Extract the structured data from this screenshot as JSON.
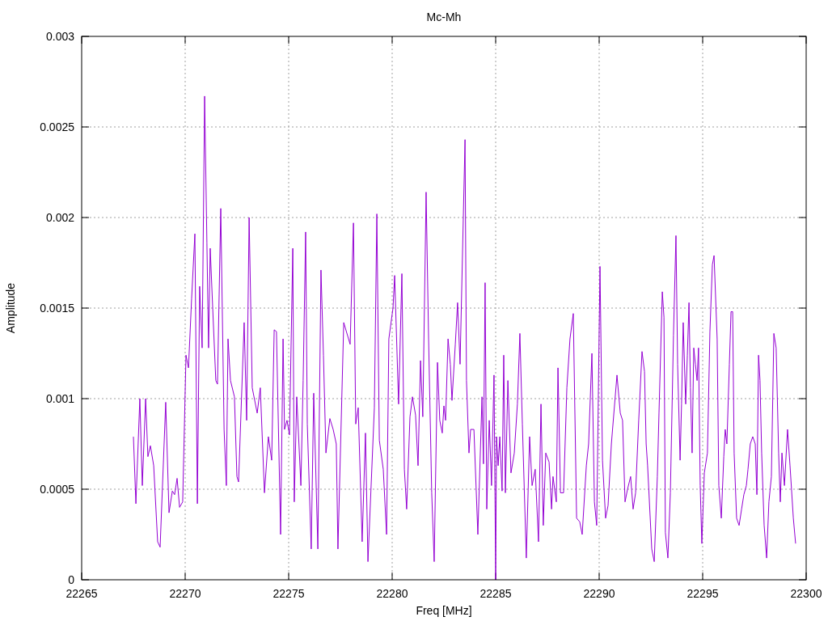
{
  "plot": {
    "chart_data": {
      "type": "line",
      "grid": true,
      "title": "Mc-Mh",
      "xlabel": "Freq [MHz]",
      "ylabel": "Amplitude",
      "xlim": [
        22265,
        22300
      ],
      "ylim": [
        0,
        0.003
      ],
      "xticks": [
        22265,
        22270,
        22275,
        22280,
        22285,
        22290,
        22295,
        22300
      ],
      "yticks": [
        0,
        0.0005,
        0.001,
        0.0015,
        0.002,
        0.0025,
        0.003
      ],
      "x": [
        22267.5,
        22267.62,
        22267.81,
        22267.93,
        22268.09,
        22268.2,
        22268.32,
        22268.48,
        22268.67,
        22268.79,
        22269.06,
        22269.22,
        22269.38,
        22269.49,
        22269.61,
        22269.73,
        22269.88,
        22270.04,
        22270.16,
        22270.31,
        22270.47,
        22270.59,
        22270.7,
        22270.82,
        22270.94,
        22271.05,
        22271.13,
        22271.21,
        22271.33,
        22271.48,
        22271.56,
        22271.72,
        22271.88,
        22271.99,
        22272.07,
        22272.19,
        22272.38,
        22272.5,
        22272.58,
        22272.85,
        22272.97,
        22273.09,
        22273.24,
        22273.48,
        22273.63,
        22273.83,
        22274.02,
        22274.18,
        22274.3,
        22274.41,
        22274.61,
        22274.73,
        22274.8,
        22274.92,
        22275.04,
        22275.2,
        22275.27,
        22275.39,
        22275.59,
        22275.7,
        22275.82,
        22275.9,
        22276.09,
        22276.21,
        22276.41,
        22276.56,
        22276.68,
        22276.8,
        22276.99,
        22277.15,
        22277.3,
        22277.38,
        22277.66,
        22277.97,
        22278.13,
        22278.24,
        22278.36,
        22278.55,
        22278.71,
        22278.83,
        22279.14,
        22279.26,
        22279.38,
        22279.57,
        22279.73,
        22279.84,
        22280.04,
        22280.12,
        22280.31,
        22280.47,
        22280.59,
        22280.7,
        22280.86,
        22280.98,
        22281.13,
        22281.25,
        22281.37,
        22281.48,
        22281.64,
        22281.76,
        22281.91,
        22282.03,
        22282.19,
        22282.3,
        22282.42,
        22282.5,
        22282.58,
        22282.7,
        22282.81,
        22282.89,
        22283.05,
        22283.16,
        22283.28,
        22283.52,
        22283.59,
        22283.71,
        22283.79,
        22283.95,
        22284.14,
        22284.34,
        22284.41,
        22284.49,
        22284.57,
        22284.69,
        22284.8,
        22284.92,
        22285.0,
        22285.04,
        22285.12,
        22285.2,
        22285.31,
        22285.39,
        22285.47,
        22285.59,
        22285.74,
        22285.9,
        22286.05,
        22286.17,
        22286.29,
        22286.48,
        22286.64,
        22286.76,
        22286.91,
        22287.07,
        22287.19,
        22287.3,
        22287.42,
        22287.58,
        22287.7,
        22287.77,
        22287.93,
        22288.01,
        22288.13,
        22288.28,
        22288.44,
        22288.59,
        22288.75,
        22288.91,
        22289.06,
        22289.18,
        22289.38,
        22289.49,
        22289.65,
        22289.77,
        22289.88,
        22290.04,
        22290.16,
        22290.31,
        22290.43,
        22290.59,
        22290.86,
        22291.02,
        22291.13,
        22291.25,
        22291.37,
        22291.52,
        22291.64,
        22291.76,
        22291.91,
        22292.07,
        22292.19,
        22292.27,
        22292.34,
        22292.54,
        22292.66,
        22292.81,
        22292.89,
        22293.05,
        22293.13,
        22293.2,
        22293.32,
        22293.44,
        22293.59,
        22293.71,
        22293.79,
        22293.91,
        22293.98,
        22294.06,
        22294.18,
        22294.26,
        22294.34,
        22294.41,
        22294.49,
        22294.57,
        22294.65,
        22294.73,
        22294.8,
        22294.88,
        22294.96,
        22295.08,
        22295.23,
        22295.35,
        22295.47,
        22295.55,
        22295.7,
        22295.78,
        22295.9,
        22296.02,
        22296.09,
        22296.17,
        22296.29,
        22296.37,
        22296.45,
        22296.52,
        22296.64,
        22296.76,
        22296.88,
        22296.99,
        22297.11,
        22297.19,
        22297.3,
        22297.42,
        22297.54,
        22297.62,
        22297.7,
        22297.77,
        22297.85,
        22297.97,
        22298.09,
        22298.2,
        22298.32,
        22298.44,
        22298.55,
        22298.67,
        22298.75,
        22298.83,
        22298.95,
        22299.1,
        22299.22,
        22299.38,
        22299.49
      ],
      "series": [
        {
          "color": "#9400d3",
          "values": [
            0.00079,
            0.00042,
            0.001,
            0.00052,
            0.001,
            0.00068,
            0.00074,
            0.00063,
            0.00021,
            0.00018,
            0.00098,
            0.00037,
            0.00049,
            0.00047,
            0.00056,
            0.0004,
            0.00043,
            0.00124,
            0.00117,
            0.00155,
            0.00191,
            0.00042,
            0.00162,
            0.00128,
            0.00267,
            0.00186,
            0.00128,
            0.00183,
            0.0015,
            0.0011,
            0.00108,
            0.00205,
            0.00083,
            0.00052,
            0.00133,
            0.0011,
            0.00101,
            0.00057,
            0.00054,
            0.00142,
            0.00088,
            0.002,
            0.00106,
            0.00092,
            0.00106,
            0.00048,
            0.00079,
            0.00066,
            0.00138,
            0.00137,
            0.00025,
            0.00133,
            0.00083,
            0.00088,
            0.0008,
            0.00183,
            0.00043,
            0.00101,
            0.00052,
            0.0011,
            0.00192,
            0.00086,
            0.00017,
            0.00103,
            0.00017,
            0.00171,
            0.00124,
            0.0007,
            0.00089,
            0.00083,
            0.00075,
            0.00017,
            0.00142,
            0.0013,
            0.00197,
            0.00086,
            0.00095,
            0.00021,
            0.00081,
            0.0001,
            0.00095,
            0.00202,
            0.00077,
            0.00061,
            0.00025,
            0.00133,
            0.0015,
            0.00168,
            0.00097,
            0.00169,
            0.00061,
            0.00039,
            0.0009,
            0.00101,
            0.00091,
            0.00063,
            0.00121,
            0.0009,
            0.00214,
            0.00133,
            0.00048,
            0.0001,
            0.0012,
            0.00088,
            0.00081,
            0.00096,
            0.00088,
            0.00133,
            0.00119,
            0.00099,
            0.0013,
            0.00153,
            0.00119,
            0.00243,
            0.0011,
            0.0007,
            0.00083,
            0.00083,
            0.00025,
            0.00101,
            0.00064,
            0.00164,
            0.00039,
            0.00088,
            0.00052,
            0.00113,
            0,
            0.00079,
            0.00063,
            0.00079,
            0.00049,
            0.00124,
            0.00048,
            0.0011,
            0.00059,
            0.0007,
            0.00097,
            0.00136,
            0.00086,
            0.00012,
            0.00079,
            0.00052,
            0.00061,
            0.00021,
            0.00097,
            0.0003,
            0.0007,
            0.00065,
            0.00039,
            0.00057,
            0.00043,
            0.00117,
            0.00048,
            0.00048,
            0.00106,
            0.00133,
            0.00147,
            0.00034,
            0.00032,
            0.00025,
            0.00063,
            0.00075,
            0.00125,
            0.00043,
            0.0003,
            0.00173,
            0.00066,
            0.00034,
            0.00041,
            0.00075,
            0.00113,
            0.00092,
            0.00088,
            0.00043,
            0.0005,
            0.00057,
            0.00039,
            0.00048,
            0.00088,
            0.00126,
            0.00115,
            0.00075,
            0.00063,
            0.00017,
            0.0001,
            0.00057,
            0.00092,
            0.00159,
            0.00145,
            0.00026,
            0.00012,
            0.00048,
            0.00135,
            0.0019,
            0.00119,
            0.00066,
            0.00097,
            0.00142,
            0.00097,
            0.00124,
            0.00153,
            0.00106,
            0.0007,
            0.00128,
            0.00119,
            0.0011,
            0.00128,
            0.00052,
            0.0002,
            0.00059,
            0.0007,
            0.00137,
            0.00174,
            0.00179,
            0.00133,
            0.00052,
            0.00034,
            0.00068,
            0.00083,
            0.00075,
            0.00119,
            0.00148,
            0.00148,
            0.0007,
            0.00034,
            0.0003,
            0.00039,
            0.00047,
            0.00052,
            0.00061,
            0.00075,
            0.00079,
            0.00075,
            0.00047,
            0.00124,
            0.0011,
            0.0007,
            0.0003,
            0.00012,
            0.00043,
            0.00057,
            0.00136,
            0.00128,
            0.0007,
            0.00043,
            0.0007,
            0.00052,
            0.00083,
            0.00063,
            0.00034,
            0.0002
          ]
        }
      ]
    }
  }
}
